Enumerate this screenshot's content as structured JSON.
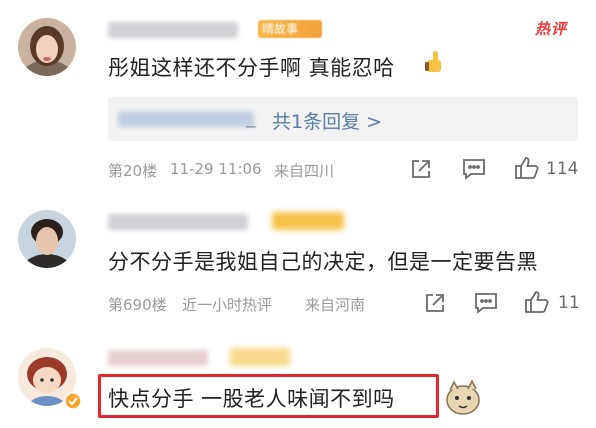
{
  "comments": [
    {
      "text": "彤姐这样还不分手啊 真能忍哈",
      "reply_prefix": "_",
      "reply_link": "共1条回复 >",
      "floor": "第20楼",
      "time": "11-29 11:06",
      "location": "来自四川",
      "like_count": "114",
      "badge_text": "晴故事",
      "hot_label": "热评"
    },
    {
      "text": "分不分手是我姐自己的决定，但是一定要告黑",
      "floor": "第690楼",
      "time": "近一小时热评",
      "location": "来自河南",
      "like_count": "11"
    },
    {
      "text": "快点分手 一股老人味闻不到吗"
    }
  ],
  "colors": {
    "hot": "#f23a3a",
    "link": "#5b7da8",
    "highlight_border": "#e0282e"
  }
}
